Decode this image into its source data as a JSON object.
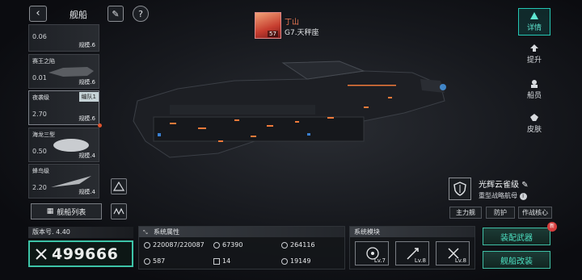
{
  "header": {
    "title": "舰船",
    "back_icon": "back-arrow-icon",
    "edit_icon": "pen-icon",
    "help_icon": "question-icon"
  },
  "ships": [
    {
      "name": "",
      "value": "0.06",
      "scale": "规模.6",
      "fleet_tag": ""
    },
    {
      "name": "赛王之陷",
      "value": "0.01",
      "scale": "规模.6",
      "fleet_tag": ""
    },
    {
      "name": "夜袭级",
      "value": "2.70",
      "scale": "规模.6",
      "fleet_tag": "编队1"
    },
    {
      "name": "海龙三型",
      "value": "0.50",
      "scale": "规模.4",
      "fleet_tag": ""
    },
    {
      "name": "蜂鸟级",
      "value": "2.20",
      "scale": "规模.4",
      "fleet_tag": ""
    }
  ],
  "ship_list_button": "舰船列表",
  "commander": {
    "name": "丁山",
    "level": "57",
    "location": "G7.天秤座"
  },
  "sidebar": [
    {
      "label": "详情",
      "icon": "details-icon"
    },
    {
      "label": "提升",
      "icon": "upgrade-icon"
    },
    {
      "label": "船员",
      "icon": "crew-icon"
    },
    {
      "label": "皮肤",
      "icon": "skin-icon"
    }
  ],
  "ship": {
    "name": "光辉云雀级",
    "type": "重型战略航母",
    "tags": [
      "主力舰",
      "防护",
      "作战核心"
    ]
  },
  "version": "版本号. 4.40",
  "power": "499666",
  "stats": {
    "header": "系统属性",
    "items": [
      {
        "value": "220087/220087",
        "icon": "hull-icon"
      },
      {
        "value": "67390",
        "icon": "armor-icon"
      },
      {
        "value": "264116",
        "icon": "shield-icon"
      },
      {
        "value": "587",
        "icon": "speed-icon"
      },
      {
        "value": "14",
        "icon": "grid-icon"
      },
      {
        "value": "19149",
        "icon": "energy-icon"
      }
    ]
  },
  "modules": {
    "header": "系统模块",
    "items": [
      {
        "level": "Lv.7",
        "icon": "target-icon"
      },
      {
        "level": "Lv.8",
        "icon": "missile-icon"
      },
      {
        "level": "Lv.8",
        "icon": "tools-icon"
      }
    ]
  },
  "actions": {
    "equip": "装配武器",
    "refit": "舰船改装",
    "new_badge": "新"
  },
  "colors": {
    "accent": "#3dc4a8",
    "alert": "#d63d3d",
    "commander": "#f07a55"
  }
}
